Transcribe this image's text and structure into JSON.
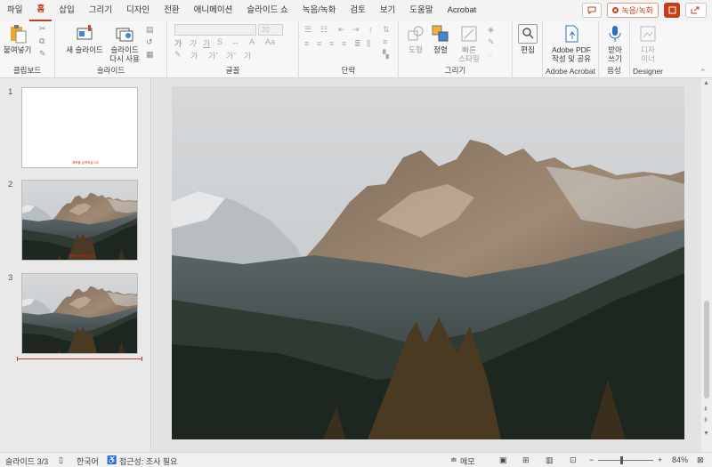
{
  "tabs": [
    "파일",
    "홈",
    "삽입",
    "그리기",
    "디자인",
    "전환",
    "애니메이션",
    "슬라이드 쇼",
    "녹음/녹화",
    "검토",
    "보기",
    "도움말",
    "Acrobat"
  ],
  "active_tab": "홈",
  "record_button": "녹음/녹화",
  "groups": {
    "clipboard": {
      "label": "클립보드",
      "paste": "붙여넣기"
    },
    "slides": {
      "label": "슬라이드",
      "new_slide": "새 슬라이드",
      "reuse_line1": "슬라이드",
      "reuse_line2": "다시 사용"
    },
    "font": {
      "label": "글꼴",
      "size": "20"
    },
    "paragraph": {
      "label": "단락"
    },
    "drawing": {
      "label": "그리기",
      "shape": "도형",
      "arrange": "정렬",
      "quick_style_line1": "빠른",
      "quick_style_line2": "스타일"
    },
    "editing": {
      "edit": "편집"
    },
    "acrobat": {
      "label": "Adobe Acrobat",
      "line1": "Adobe PDF",
      "line2": "작성 및 공유"
    },
    "voice": {
      "label": "음성",
      "dictate_line1": "받아",
      "dictate_line2": "쓰기"
    },
    "designer": {
      "label": "Designer",
      "line1": "디자",
      "line2": "이너"
    }
  },
  "slides": [
    {
      "number": "1",
      "tiny_text": "제목을 입력하십시오"
    },
    {
      "number": "2",
      "tiny_text": "제목을 입력하십시오"
    },
    {
      "number": "3"
    }
  ],
  "status": {
    "slide_info": "슬라이드 3/3",
    "language": "한국어",
    "accessibility": "접근성: 조사 필요",
    "notes": "메모",
    "zoom": "84%"
  },
  "colors": {
    "accent": "#c43e1c",
    "tab_bg": "#f3f3f3",
    "ribbon_bg": "#f7f7f7"
  }
}
